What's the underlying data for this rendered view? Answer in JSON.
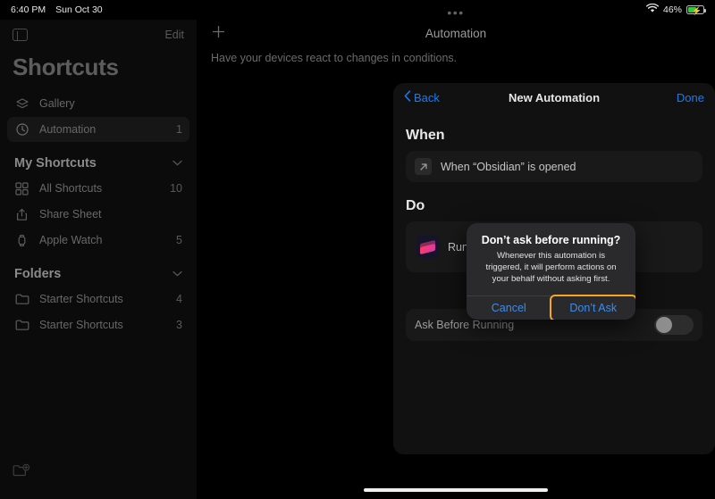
{
  "status_bar": {
    "time": "6:40 PM",
    "date": "Sun Oct 30",
    "battery_percent": "46%",
    "wifi_icon": "wifi-icon",
    "battery_icon": "battery-charging-icon"
  },
  "sidebar": {
    "toggle_icon": "sidebar-toggle-icon",
    "edit_label": "Edit",
    "title": "Shortcuts",
    "new_folder_icon": "new-folder-icon",
    "items": [
      {
        "label": "Gallery",
        "icon": "gallery-icon",
        "count": "",
        "selected": false
      },
      {
        "label": "Automation",
        "icon": "clock-icon",
        "count": "1",
        "selected": true
      }
    ],
    "groups": [
      {
        "title": "My Shortcuts",
        "chevron": "chevron-down-icon",
        "items": [
          {
            "label": "All Shortcuts",
            "icon": "grid-icon",
            "count": "10"
          },
          {
            "label": "Share Sheet",
            "icon": "share-icon",
            "count": ""
          },
          {
            "label": "Apple Watch",
            "icon": "apple-watch-icon",
            "count": "5"
          }
        ]
      },
      {
        "title": "Folders",
        "chevron": "chevron-down-icon",
        "items": [
          {
            "label": "Starter Shortcuts",
            "icon": "folder-icon",
            "count": "4"
          },
          {
            "label": "Starter Shortcuts",
            "icon": "folder-icon",
            "count": "3"
          }
        ]
      }
    ]
  },
  "main": {
    "grabber": "•••",
    "add_icon": "plus-icon",
    "title": "Automation",
    "subtitle": "Have your devices react to changes in conditions.",
    "background_card_chevron": "chevron-right-icon"
  },
  "sheet": {
    "back_label": "Back",
    "back_chevron": "chevron-left-icon",
    "title": "New Automation",
    "done_label": "Done",
    "when_header": "When",
    "when_row": {
      "icon": "arrow-up-right-icon",
      "text": "When “Obsidian” is opened"
    },
    "do_header": "Do",
    "do_row": {
      "icon": "shortcuts-app-icon",
      "text": "Run Shortcut"
    },
    "ask_before_running": {
      "label": "Ask Before Running",
      "toggle_state": "off"
    }
  },
  "alert": {
    "title": "Don’t ask before running?",
    "message": "Whenever this automation is triggered, it will perform actions on your behalf without asking first.",
    "cancel_label": "Cancel",
    "confirm_label": "Don’t Ask",
    "focus_color": "#f5a623",
    "action_color": "#3a8cf0"
  },
  "home_indicator": "home-indicator"
}
